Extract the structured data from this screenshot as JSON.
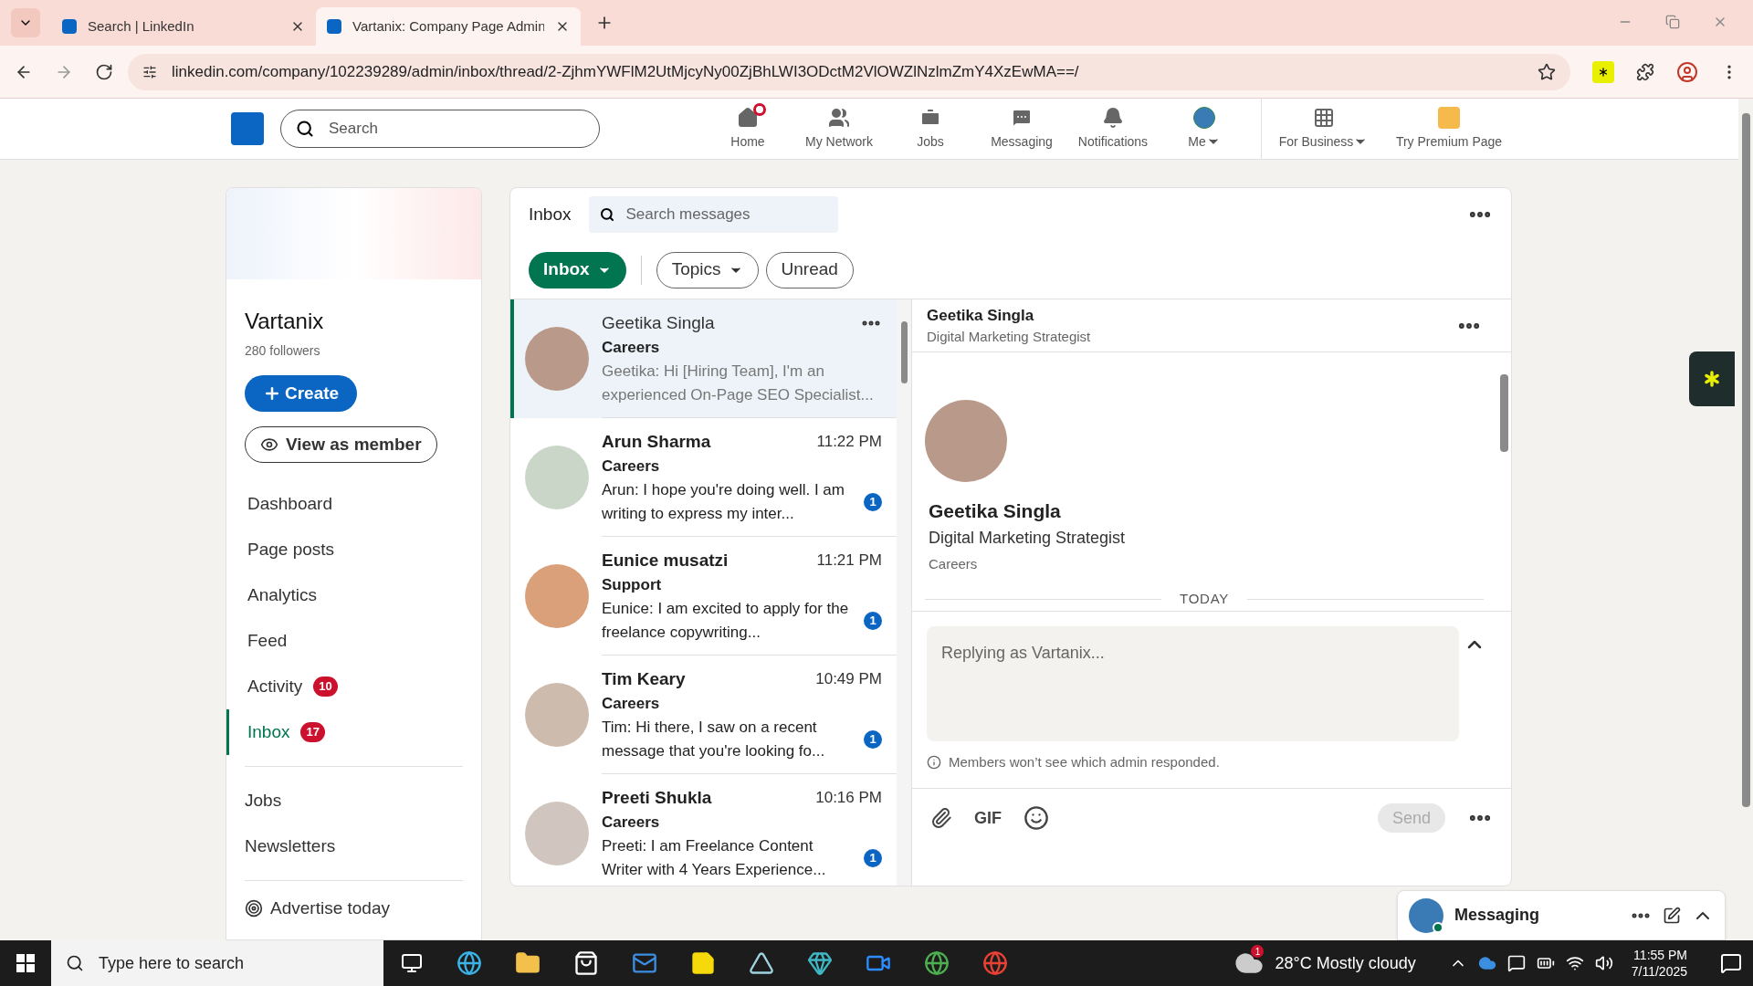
{
  "browser": {
    "tabs": [
      {
        "title": "Search | LinkedIn",
        "selected": false
      },
      {
        "title": "Vartanix: Company Page Admin",
        "selected": true
      }
    ],
    "url": "linkedin.com/company/102239289/admin/inbox/thread/2-ZjhmYWFlM2UtMjcyNy00ZjBhLWI3ODctM2VlOWZlNzlmZmY4XzEwMA==/"
  },
  "header": {
    "search_placeholder": "Search",
    "nav": [
      {
        "label": "Home",
        "kind": "home",
        "dot": true,
        "dropdown": false
      },
      {
        "label": "My Network",
        "kind": "network",
        "dot": false,
        "dropdown": false
      },
      {
        "label": "Jobs",
        "kind": "jobs",
        "dot": false,
        "dropdown": false
      },
      {
        "label": "Messaging",
        "kind": "messaging",
        "dot": false,
        "dropdown": false
      },
      {
        "label": "Notifications",
        "kind": "notifications",
        "dot": false,
        "dropdown": false
      },
      {
        "label": "Me",
        "kind": "me",
        "dot": false,
        "dropdown": true
      },
      {
        "label": "For Business",
        "kind": "business",
        "dot": false,
        "dropdown": true
      },
      {
        "label": "Try Premium Page",
        "kind": "premium",
        "dot": false,
        "dropdown": false
      }
    ]
  },
  "sidebar": {
    "name": "Vartanix",
    "followers": "280 followers",
    "create": "Create",
    "view_as_member": "View as member",
    "nav": [
      {
        "label": "Dashboard",
        "selected": false
      },
      {
        "label": "Page posts",
        "selected": false
      },
      {
        "label": "Analytics",
        "selected": false
      },
      {
        "label": "Feed",
        "selected": false
      },
      {
        "label": "Activity",
        "selected": false,
        "badge": "10"
      },
      {
        "label": "Inbox",
        "selected": true,
        "badge": "17"
      }
    ],
    "more": [
      {
        "label": "Jobs"
      },
      {
        "label": "Newsletters"
      }
    ],
    "advertise": "Advertise today"
  },
  "inbox": {
    "title": "Inbox",
    "search_placeholder": "Search messages",
    "filters": [
      {
        "label": "Inbox",
        "selected": true,
        "dropdown": true
      },
      {
        "label": "Topics",
        "selected": false,
        "dropdown": true
      },
      {
        "label": "Unread",
        "selected": false,
        "dropdown": false
      }
    ],
    "conversations": [
      {
        "name": "Geetika Singla",
        "topic": "Careers",
        "preview": "Geetika: Hi [Hiring Team], I'm an experienced On-Page SEO Specialist...",
        "selected": true,
        "unread": false
      },
      {
        "name": "Arun Sharma",
        "time": "11:22 PM",
        "topic": "Careers",
        "preview": "Arun: I hope you're doing well. I am writing to express my inter...",
        "selected": false,
        "unread": true,
        "count": "1"
      },
      {
        "name": "Eunice musatzi",
        "time": "11:21 PM",
        "topic": "Support",
        "preview": "Eunice: I am excited to apply for the freelance copywriting...",
        "selected": false,
        "unread": true,
        "count": "1"
      },
      {
        "name": "Tim Keary",
        "time": "10:49 PM",
        "topic": "Careers",
        "preview": "Tim: Hi there, I saw on a recent message that you're looking fo...",
        "selected": false,
        "unread": true,
        "count": "1"
      },
      {
        "name": "Preeti Shukla",
        "time": "10:16 PM",
        "topic": "Careers",
        "preview": "Preeti: I am Freelance Content Writer with 4 Years Experience...",
        "selected": false,
        "unread": true,
        "count": "1"
      }
    ]
  },
  "conversation": {
    "name": "Geetika Singla",
    "headline": "Digital Marketing Strategist",
    "profile_name": "Geetika Singla",
    "profile_headline": "Digital Marketing Strategist",
    "profile_topic": "Careers",
    "day": "TODAY",
    "reply_placeholder": "Replying as Vartanix...",
    "note": "Members won’t see which admin responded.",
    "gif": "GIF",
    "send": "Send",
    "send_disabled": true
  },
  "messaging_bar": {
    "label": "Messaging",
    "online": true
  },
  "taskbar": {
    "search_placeholder": "Type here to search",
    "weather_badge": "1",
    "weather": "28°C Mostly cloudy",
    "time": "11:55 PM",
    "date": "7/11/2025"
  }
}
